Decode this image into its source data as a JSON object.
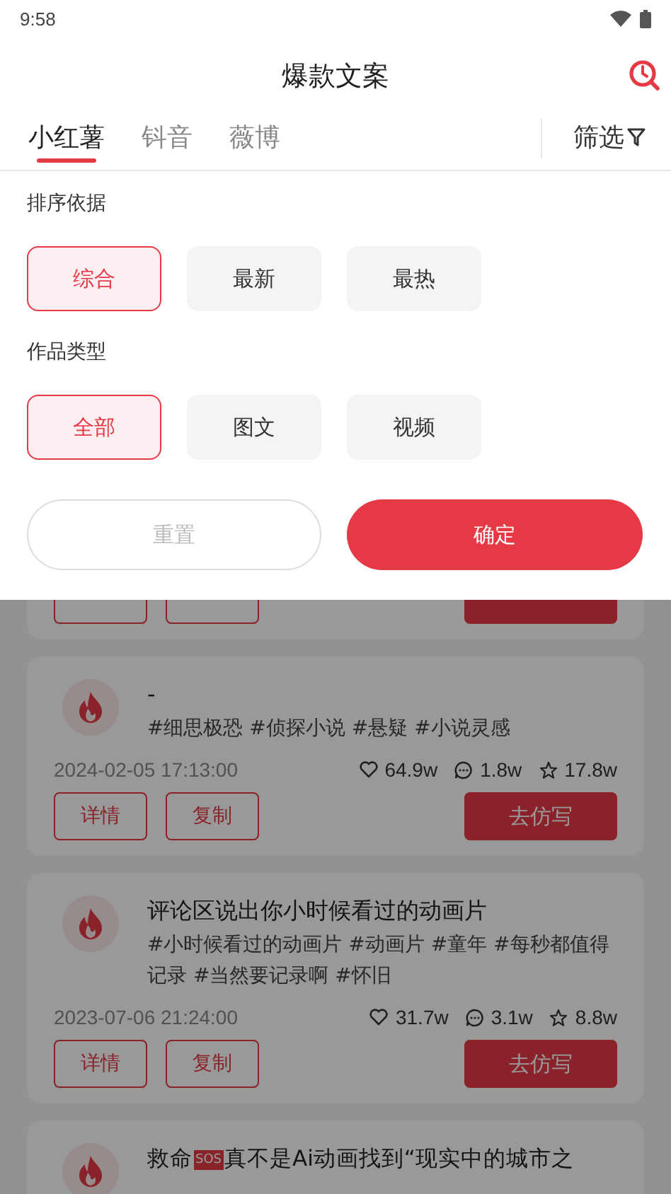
{
  "status_bar": {
    "time": "9:58"
  },
  "header": {
    "title": "爆款文案"
  },
  "tabs": [
    {
      "label": "小红薯",
      "selected": true
    },
    {
      "label": "钭音",
      "selected": false
    },
    {
      "label": "薇博",
      "selected": false
    }
  ],
  "filter_button": {
    "label": "筛选"
  },
  "filter_panel": {
    "sections": [
      {
        "title": "排序依据",
        "options": [
          {
            "label": "综合",
            "selected": true
          },
          {
            "label": "最新",
            "selected": false
          },
          {
            "label": "最热",
            "selected": false
          }
        ]
      },
      {
        "title": "作品类型",
        "options": [
          {
            "label": "全部",
            "selected": true
          },
          {
            "label": "图文",
            "selected": false
          },
          {
            "label": "视频",
            "selected": false
          }
        ]
      }
    ],
    "reset_button": "重置",
    "confirm_button": "确定"
  },
  "cards": [
    {
      "title": "-",
      "tags": "#细思极恐 #侦探小说 #悬疑 #小说灵感",
      "date": "2024-02-05 17:13:00",
      "likes": "64.9w",
      "comments": "1.8w",
      "favorites": "17.8w",
      "buttons": [
        "详情",
        "复制",
        "去仿写"
      ]
    },
    {
      "title": "评论区说出你小时候看过的动画片",
      "tags": "#小时候看过的动画片 #动画片 #童年 #每秒都值得记录 #当然要记录啊 #怀旧",
      "date": "2023-07-06 21:24:00",
      "likes": "31.7w",
      "comments": "3.1w",
      "favorites": "8.8w",
      "buttons": [
        "详情",
        "复制",
        "去仿写"
      ]
    }
  ],
  "cut_card": {
    "title_start": "救命",
    "badge": "SOS",
    "title_rest": "真不是Ai动画找到“现实中的城市之"
  }
}
